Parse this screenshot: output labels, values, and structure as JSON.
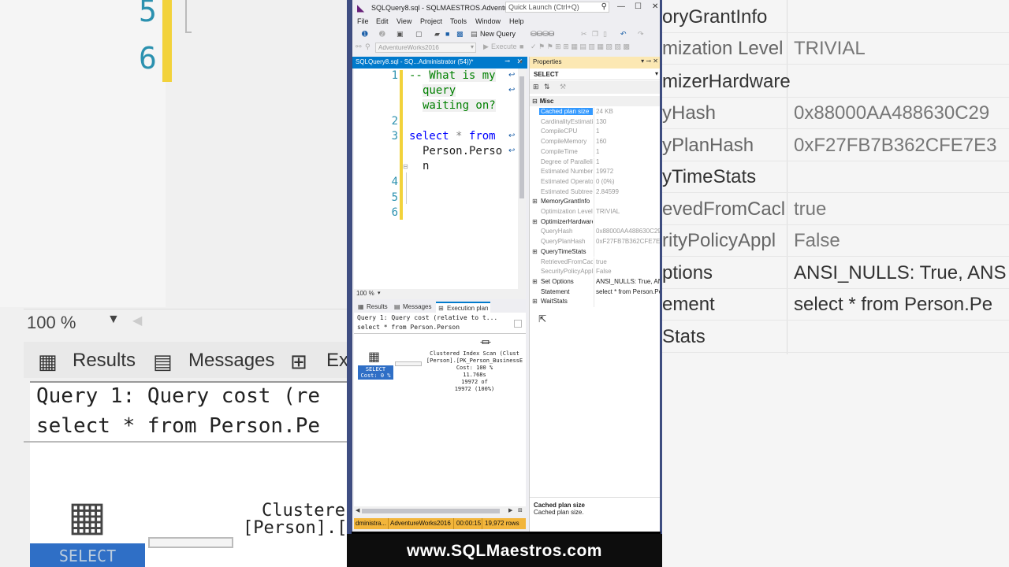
{
  "background_left": {
    "line_numbers": [
      "5",
      "6"
    ],
    "zoom": "100 %",
    "tabs": [
      "Results",
      "Messages",
      "Ex"
    ],
    "query_line": "Query 1: Query cost (re",
    "sql_line": "select * from Person.Pe",
    "scan_line1": "Clustere",
    "scan_line2": "[Person].[",
    "select_label": "SELECT"
  },
  "background_right": {
    "rows": [
      {
        "key": "oryGrantInfo",
        "value": ""
      },
      {
        "key": "mization Level",
        "value": "TRIVIAL"
      },
      {
        "key": "mizerHardware",
        "value": ""
      },
      {
        "key": "yHash",
        "value": "0x88000AA488630C29"
      },
      {
        "key": "yPlanHash",
        "value": "0xF27FB7B362CFE7E3"
      },
      {
        "key": "yTimeStats",
        "value": ""
      },
      {
        "key": "evedFromCacl",
        "value": "true"
      },
      {
        "key": "rityPolicyAppl",
        "value": "False"
      },
      {
        "key": "ptions",
        "value": "ANSI_NULLS: True, ANS"
      },
      {
        "key": "ement",
        "value": "select * from Person.Pe"
      },
      {
        "key": "Stats",
        "value": ""
      }
    ]
  },
  "window": {
    "title": "SQLQuery8.sql - SQLMAESTROS.AdventureW...",
    "quick_launch_placeholder": "Quick Launch (Ctrl+Q)",
    "menu": [
      "File",
      "Edit",
      "View",
      "Project",
      "Tools",
      "Window",
      "Help"
    ],
    "new_query": "New Query",
    "database": "AdventureWorks2016",
    "execute": "Execute",
    "tab_title": "SQLQuery8.sql - SQ...Administrator (54))*"
  },
  "editor": {
    "line_numbers": [
      "1",
      "2",
      "3",
      "4",
      "5",
      "6"
    ],
    "comment_prefix": "-- ",
    "comment_l1": "What is my",
    "comment_l2": "query",
    "comment_l3": "waiting on?",
    "kw_select": "select",
    "star": "*",
    "kw_from": "from",
    "table_l1": "Person.Perso",
    "table_l2": "n",
    "zoom": "100 %"
  },
  "results": {
    "tabs": [
      "Results",
      "Messages",
      "Execution plan"
    ],
    "query_cost_line": "Query 1: Query cost (relative to t...",
    "sql_line": "select * from Person.Person",
    "select_node": "SELECT",
    "select_cost": "Cost: 0 %",
    "scan_title": "Clustered Index Scan (Clust",
    "scan_object": "[Person].[PK_Person_BusinessE",
    "scan_cost": "Cost: 100 %",
    "scan_time": "11.768s",
    "scan_rows1": "19972 of",
    "scan_rows2": "19972 (100%)"
  },
  "status": {
    "user": "dministra...",
    "db": "AdventureWorks2016",
    "time": "00:00:15",
    "rows": "19,972 rows"
  },
  "properties": {
    "title": "Properties",
    "object": "SELECT",
    "category": "Misc",
    "rows": [
      {
        "exp": "",
        "key": "Cached plan size",
        "value": "24 KB",
        "selected": true,
        "category": false
      },
      {
        "exp": "",
        "key": "CardinalityEstimati",
        "value": "130",
        "selected": false,
        "category": false
      },
      {
        "exp": "",
        "key": "CompileCPU",
        "value": "1",
        "selected": false,
        "category": false
      },
      {
        "exp": "",
        "key": "CompileMemory",
        "value": "160",
        "selected": false,
        "category": false
      },
      {
        "exp": "",
        "key": "CompileTime",
        "value": "1",
        "selected": false,
        "category": false
      },
      {
        "exp": "",
        "key": "Degree of Parallelis",
        "value": "1",
        "selected": false,
        "category": false
      },
      {
        "exp": "",
        "key": "Estimated Number",
        "value": "19972",
        "selected": false,
        "category": false
      },
      {
        "exp": "",
        "key": "Estimated Operator",
        "value": "0 (0%)",
        "selected": false,
        "category": false
      },
      {
        "exp": "",
        "key": "Estimated Subtree",
        "value": "2.84599",
        "selected": false,
        "category": false
      },
      {
        "exp": "⊞",
        "key": "MemoryGrantInfo",
        "value": "",
        "selected": false,
        "category": true
      },
      {
        "exp": "",
        "key": "Optimization Level",
        "value": "TRIVIAL",
        "selected": false,
        "category": false
      },
      {
        "exp": "⊞",
        "key": "OptimizerHardware",
        "value": "",
        "selected": false,
        "category": true
      },
      {
        "exp": "",
        "key": "QueryHash",
        "value": "0x88000AA488630C29",
        "selected": false,
        "category": false
      },
      {
        "exp": "",
        "key": "QueryPlanHash",
        "value": "0xF27FB7B362CFE7E3",
        "selected": false,
        "category": false
      },
      {
        "exp": "⊞",
        "key": "QueryTimeStats",
        "value": "",
        "selected": false,
        "category": true
      },
      {
        "exp": "",
        "key": "RetrievedFromCacl",
        "value": "true",
        "selected": false,
        "category": false
      },
      {
        "exp": "",
        "key": "SecurityPolicyAppl",
        "value": "False",
        "selected": false,
        "category": false
      },
      {
        "exp": "⊞",
        "key": "Set Options",
        "value": "ANSI_NULLS: True, ANS",
        "selected": false,
        "category": true
      },
      {
        "exp": "",
        "key": "Statement",
        "value": "select * from Person.Pe",
        "selected": false,
        "category": true
      },
      {
        "exp": "⊞",
        "key": "WaitStats",
        "value": "",
        "selected": false,
        "category": true
      }
    ],
    "desc_title": "Cached plan size",
    "desc_text": "Cached plan size."
  },
  "footer": {
    "url": "www.SQLMaestros.com"
  }
}
